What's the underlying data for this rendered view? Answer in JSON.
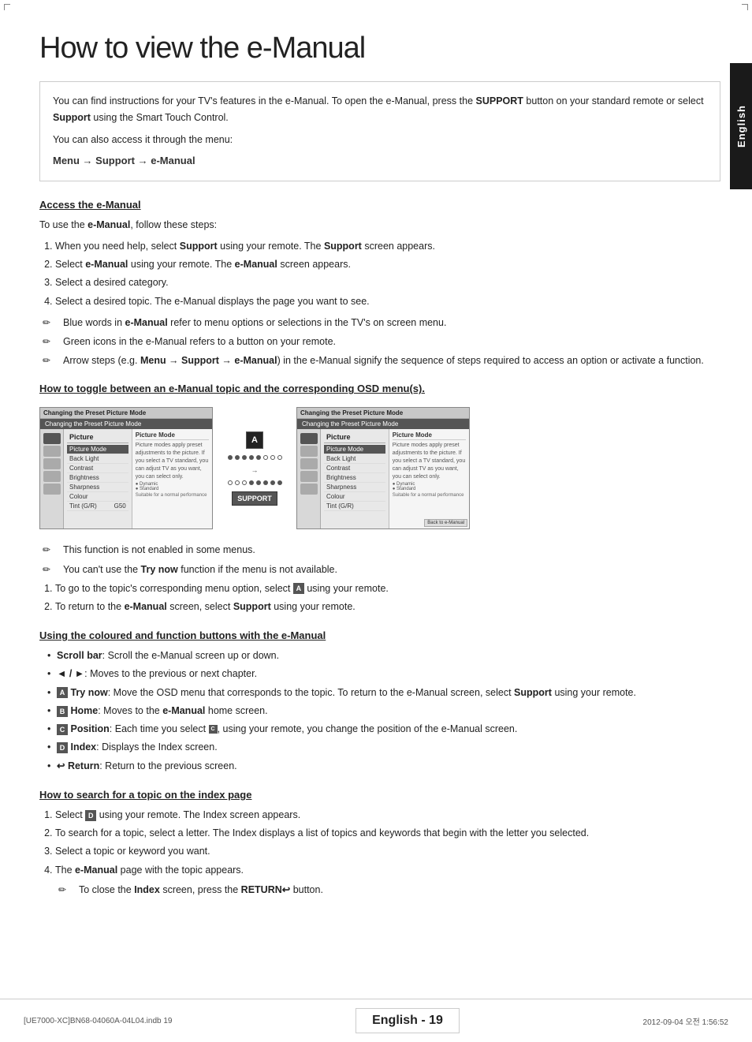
{
  "page": {
    "title": "How to view the e-Manual",
    "side_tab": "English"
  },
  "intro": {
    "text1": "You can find instructions for your TV's features in the e-Manual. To open the e-Manual, press the ",
    "support_bold": "SUPPORT",
    "text2": " button on your standard remote or select ",
    "smart_touch": "Support",
    "text3": " using the Smart Touch Control.",
    "text4": "You can also access it through the menu:",
    "menu_path": "Menu → Support → e-Manual"
  },
  "sections": {
    "access_heading": "Access the e-Manual",
    "access_intro": "To use the e-Manual, follow these steps:",
    "access_steps": [
      "When you need help, select Support using your remote. The Support screen appears.",
      "Select e-Manual using your remote. The e-Manual screen appears.",
      "Select a desired category.",
      "Select a desired topic. The e-Manual displays the page you want to see."
    ],
    "access_notes": [
      "Blue words in e-Manual refer to menu options or selections in the TV's on screen menu.",
      "Green icons in the e-Manual refers to a button on your remote.",
      "Arrow steps (e.g. Menu → Support → e-Manual) in the e-Manual signify the sequence of steps required to access an option or activate a function."
    ],
    "toggle_heading": "How to toggle between an e-Manual topic and the corresponding OSD menu(s).",
    "diagram": {
      "left_header": "Changing the Preset Picture Mode",
      "left_menu_title": "Picture",
      "left_items": [
        "Picture Mode",
        "Back Light",
        "Contrast",
        "Brightness",
        "Sharpness",
        "Colour",
        "Tint (G/R)"
      ],
      "left_tint_value": "G50",
      "left_selected": "Picture Mode",
      "left_content_title": "Picture Mode",
      "left_content_text": "Picture mode apply preset adjustments to the picture.",
      "btn_a_label": "A",
      "dots_left": [
        "filled",
        "filled",
        "filled",
        "filled",
        "filled",
        "hollow",
        "hollow",
        "hollow",
        "hollow"
      ],
      "dots_right": [
        "hollow",
        "hollow",
        "hollow",
        "filled",
        "filled",
        "filled",
        "filled",
        "filled",
        "filled"
      ],
      "support_label": "SUPPORT",
      "right_header": "Changing the Preset Picture Mode",
      "right_menu_title": "Picture",
      "right_items": [
        "Picture Mode",
        "Back Light",
        "Contrast",
        "Brightness",
        "Sharpness",
        "Colour",
        "Tint (G/R)"
      ],
      "right_selected": "Picture Mode",
      "right_content_title": "Picture Mode",
      "right_content_text": "Picture mode apply preset adjustments to the picture.",
      "back_label": "Back to e-Manual"
    },
    "toggle_notes": [
      "This function is not enabled in some menus.",
      "You can't use the Try now function if the menu is not available."
    ],
    "toggle_steps": [
      "To go to the topic's corresponding menu option, select A using your remote.",
      "To return to the e-Manual screen, select Support using your remote."
    ],
    "coloured_heading": "Using the coloured and function buttons with the e-Manual",
    "coloured_bullets": [
      "Scroll bar: Scroll the e-Manual screen up or down.",
      "◄ / ►: Moves to the previous or next chapter.",
      "Try now: Move the OSD menu that corresponds to the topic. To return to the e-Manual screen, select Support using your remote.",
      "Home: Moves to the e-Manual home screen.",
      "Position: Each time you select , using your remote, you change the position of the e-Manual screen.",
      "Index: Displays the Index screen.",
      "Return: Return to the previous screen."
    ],
    "coloured_bullet_bolds": [
      "Scroll bar",
      "◄ / ►",
      "Try now",
      "Home",
      "Position",
      "Index",
      "Return"
    ],
    "coloured_icons": [
      "",
      "",
      "A",
      "B",
      "C",
      "D",
      "↩"
    ],
    "search_heading": "How to search for a topic on the index page",
    "search_steps": [
      "Select  using your remote. The Index screen appears.",
      "To search for a topic, select a letter. The Index displays a list of topics and keywords that begin with the letter you selected.",
      "Select a topic or keyword you want.",
      "The e-Manual page with the topic appears."
    ],
    "search_note": "To close the Index screen, press the RETURN↩ button."
  },
  "footer": {
    "left": "[UE7000-XC]BN68-04060A-04L04.indb   19",
    "page_label": "English - 19",
    "right": "2012-09-04   오전 1:56:52"
  }
}
